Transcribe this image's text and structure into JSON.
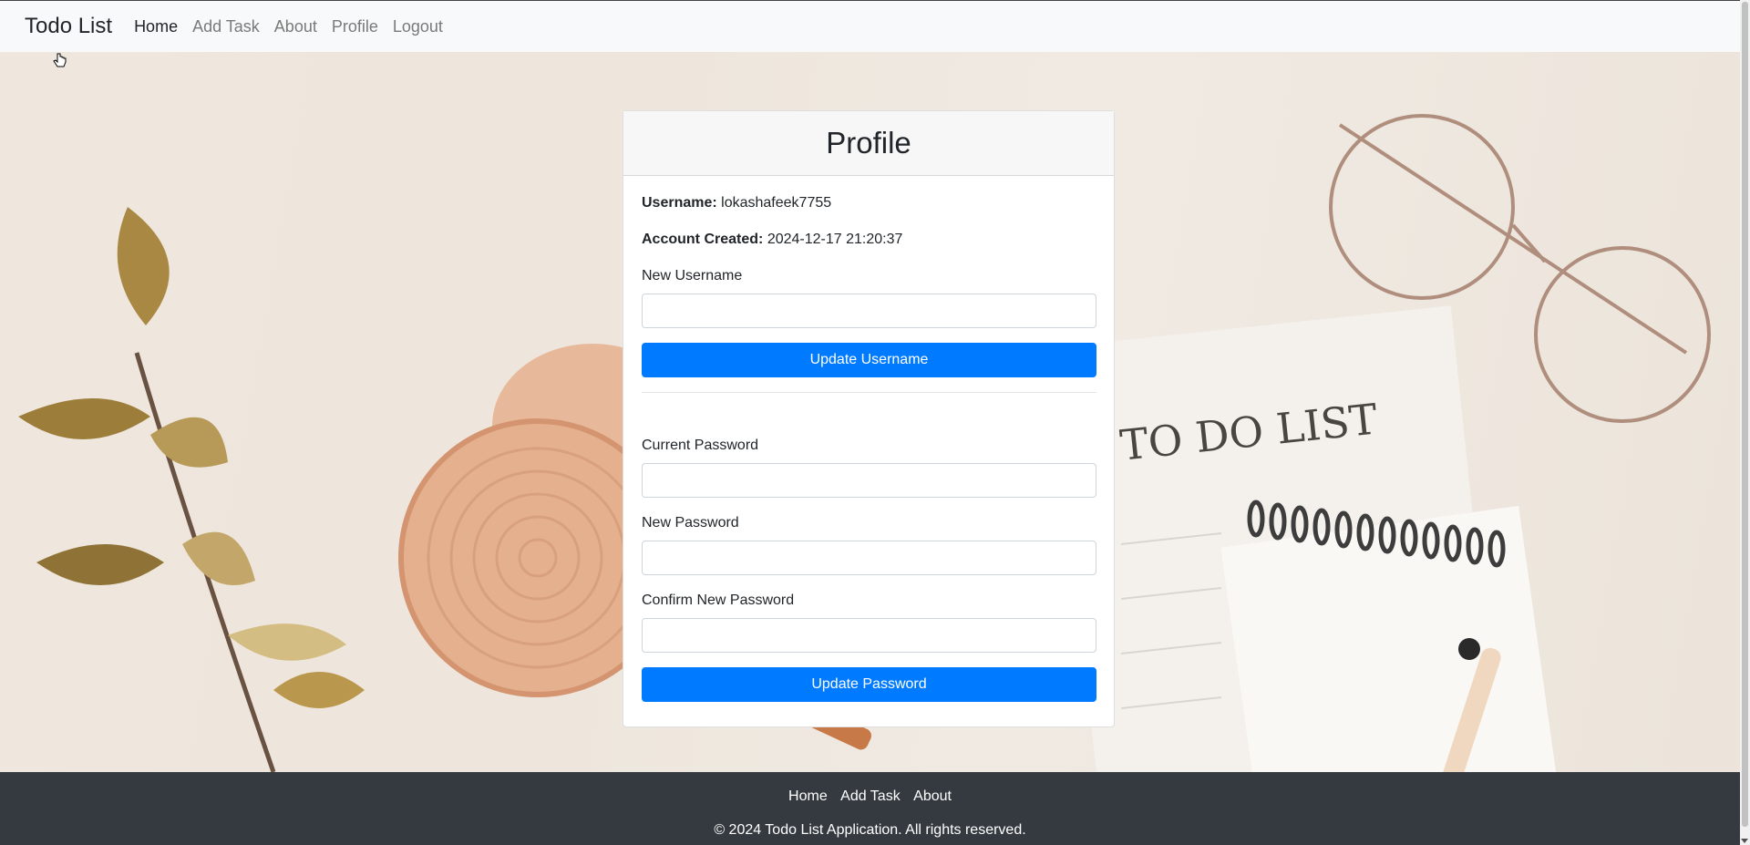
{
  "navbar": {
    "brand": "Todo List",
    "links": [
      "Home",
      "Add Task",
      "About",
      "Profile",
      "Logout"
    ],
    "active": "Home"
  },
  "profile": {
    "title": "Profile",
    "username_label": "Username:",
    "username_value": "lokashafeek7755",
    "created_label": "Account Created:",
    "created_value": "2024-12-17 21:20:37",
    "new_username_label": "New Username",
    "update_username_button": "Update Username",
    "current_password_label": "Current Password",
    "new_password_label": "New Password",
    "confirm_password_label": "Confirm New Password",
    "update_password_button": "Update Password"
  },
  "background_text": "TO DO LIST",
  "footer": {
    "links": [
      "Home",
      "Add Task",
      "About"
    ],
    "copyright": "© 2024 Todo List Application. All rights reserved."
  },
  "colors": {
    "primary": "#007bff",
    "navbar_bg": "#f8f9fa",
    "footer_bg": "#343a40"
  }
}
